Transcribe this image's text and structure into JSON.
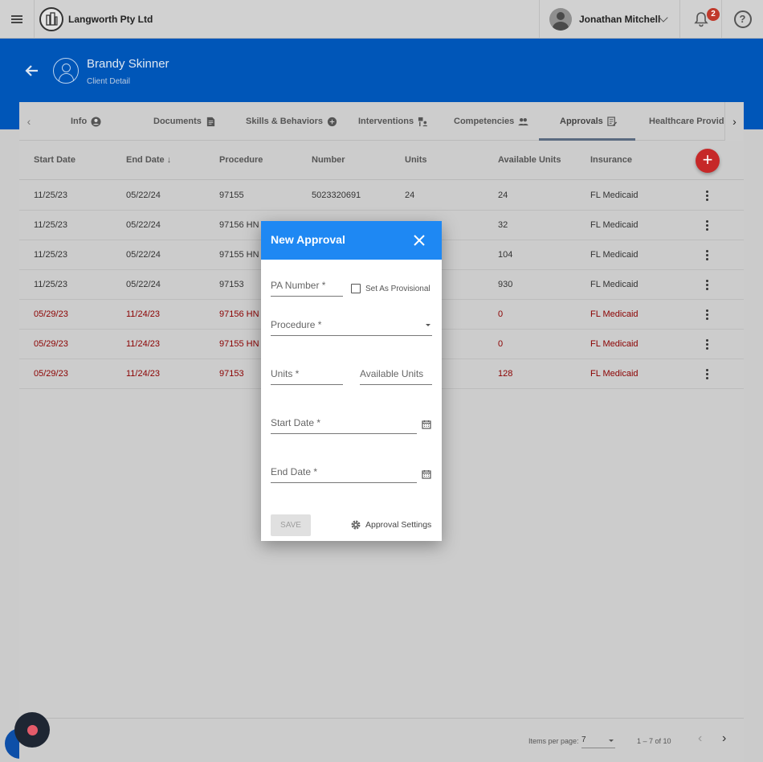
{
  "topbar": {
    "company_name": "Langworth Pty Ltd",
    "user_name": "Jonathan Mitchell",
    "notification_count": "2",
    "help_label": "?"
  },
  "client": {
    "name": "Brandy Skinner",
    "subtitle": "Client Detail"
  },
  "tabs": [
    {
      "label": "Info",
      "icon": "account-circle-icon"
    },
    {
      "label": "Documents",
      "icon": "document-icon"
    },
    {
      "label": "Skills & Behaviors",
      "icon": "brain-icon"
    },
    {
      "label": "Interventions",
      "icon": "people-interaction-icon"
    },
    {
      "label": "Competencies",
      "icon": "group-icon"
    },
    {
      "label": "Approvals",
      "icon": "approval-edit-icon",
      "active": true
    },
    {
      "label": "Healthcare Providers",
      "icon": "healthcare-icon"
    }
  ],
  "table": {
    "columns": [
      "Start Date",
      "End Date",
      "Procedure",
      "Number",
      "Units",
      "Available Units",
      "Insurance"
    ],
    "sort_column": "End Date",
    "rows": [
      {
        "start": "11/25/23",
        "end": "05/22/24",
        "procedure": "97155",
        "number": "5023320691",
        "units": "24",
        "available": "24",
        "insurance": "FL Medicaid",
        "expired": false
      },
      {
        "start": "11/25/23",
        "end": "05/22/24",
        "procedure": "97156 HN",
        "number": "",
        "units": "",
        "available": "32",
        "insurance": "FL Medicaid",
        "expired": false
      },
      {
        "start": "11/25/23",
        "end": "05/22/24",
        "procedure": "97155 HN",
        "number": "",
        "units": "",
        "available": "104",
        "insurance": "FL Medicaid",
        "expired": false
      },
      {
        "start": "11/25/23",
        "end": "05/22/24",
        "procedure": "97153",
        "number": "",
        "units": "",
        "available": "930",
        "insurance": "FL Medicaid",
        "expired": false
      },
      {
        "start": "05/29/23",
        "end": "11/24/23",
        "procedure": "97156 HN",
        "number": "",
        "units": "",
        "available": "0",
        "insurance": "FL Medicaid",
        "expired": true
      },
      {
        "start": "05/29/23",
        "end": "11/24/23",
        "procedure": "97155 HN",
        "number": "",
        "units": "",
        "available": "0",
        "insurance": "FL Medicaid",
        "expired": true
      },
      {
        "start": "05/29/23",
        "end": "11/24/23",
        "procedure": "97153",
        "number": "",
        "units": "",
        "available": "128",
        "insurance": "FL Medicaid",
        "expired": true
      }
    ]
  },
  "paginator": {
    "items_per_page_label": "Items per page:",
    "page_size": "7",
    "range": "1 – 7 of 10"
  },
  "dialog": {
    "title": "New Approval",
    "pa_number_placeholder": "PA Number *",
    "provisional_label": "Set As Provisional",
    "procedure_placeholder": "Procedure *",
    "units_placeholder": "Units *",
    "available_units_placeholder": "Available Units",
    "start_date_placeholder": "Start Date *",
    "end_date_placeholder": "End Date *",
    "save_label": "SAVE",
    "settings_label": "Approval Settings"
  },
  "colors": {
    "brand_blue": "#0056b8",
    "dialog_header": "#1e88f3",
    "add_button": "#c62828",
    "expired_text": "#8b0000"
  }
}
